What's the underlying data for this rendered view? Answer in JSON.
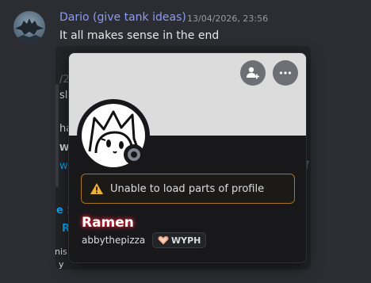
{
  "message": {
    "author": "Dario (give tank ideas)",
    "timestamp": "13/04/2026, 23:56",
    "text": "It all makes sense in the end"
  },
  "embed_fragments": [
    "/2",
    "sl",
    "ha",
    "W",
    "w",
    "f",
    "e S",
    "R",
    "nis",
    "y"
  ],
  "profile": {
    "warning": "Unable to load parts of profile",
    "display_name": "Ramen",
    "username": "abbythepizza",
    "guild_tag": "WYPH",
    "colors": {
      "banner": "#dcdcdc",
      "name_glow": "#e0283a",
      "warning_border": "#a8751d",
      "status": "#80848e"
    },
    "icons": [
      "add-friend-icon",
      "more-options-icon",
      "warning-icon",
      "heart-icon"
    ]
  }
}
